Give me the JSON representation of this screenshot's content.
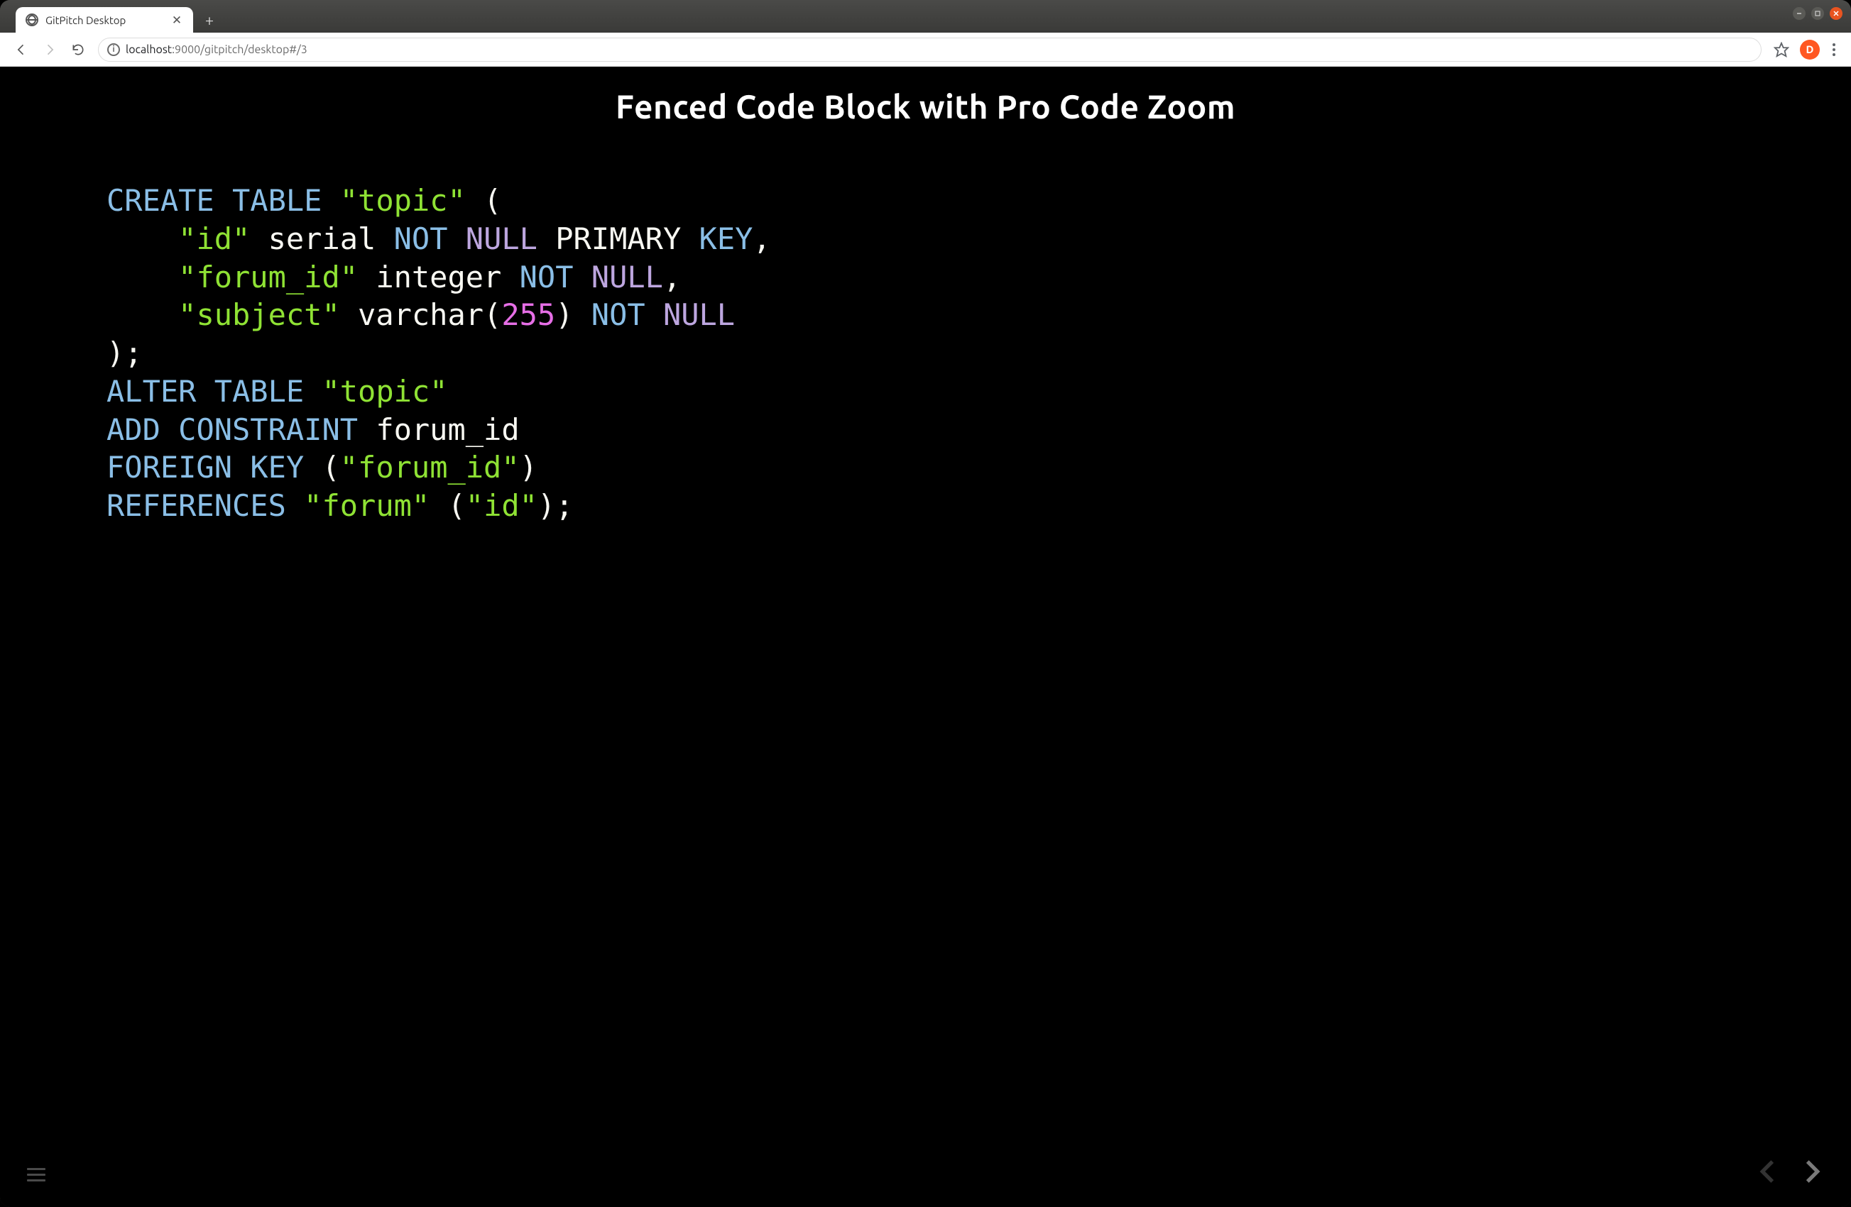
{
  "window": {
    "tab_title": "GitPitch Desktop",
    "controls": {
      "minimize": "minimize",
      "maximize": "maximize",
      "close": "close"
    }
  },
  "toolbar": {
    "url_host": "localhost",
    "url_port_path": ":9000/gitpitch/desktop#/3",
    "avatar_initial": "D"
  },
  "slide": {
    "title": "Fenced Code Block with Pro Code Zoom",
    "code_tokens": [
      [
        {
          "c": "tok-kw",
          "t": "CREATE"
        },
        {
          "c": "sp",
          "t": " "
        },
        {
          "c": "tok-kw",
          "t": "TABLE"
        },
        {
          "c": "sp",
          "t": " "
        },
        {
          "c": "tok-str",
          "t": "\"topic\""
        },
        {
          "c": "sp",
          "t": " "
        },
        {
          "c": "tok-punc",
          "t": "("
        }
      ],
      [
        {
          "c": "sp",
          "t": "    "
        },
        {
          "c": "tok-str",
          "t": "\"id\""
        },
        {
          "c": "sp",
          "t": " "
        },
        {
          "c": "tok-id",
          "t": "serial"
        },
        {
          "c": "sp",
          "t": " "
        },
        {
          "c": "tok-kw",
          "t": "NOT"
        },
        {
          "c": "sp",
          "t": " "
        },
        {
          "c": "tok-pk1",
          "t": "NULL"
        },
        {
          "c": "sp",
          "t": " "
        },
        {
          "c": "tok-id",
          "t": "PRIMARY"
        },
        {
          "c": "sp",
          "t": " "
        },
        {
          "c": "tok-pk2",
          "t": "KEY"
        },
        {
          "c": "tok-punc",
          "t": ","
        }
      ],
      [
        {
          "c": "sp",
          "t": "    "
        },
        {
          "c": "tok-str",
          "t": "\"forum_id\""
        },
        {
          "c": "sp",
          "t": " "
        },
        {
          "c": "tok-id",
          "t": "integer"
        },
        {
          "c": "sp",
          "t": " "
        },
        {
          "c": "tok-kw",
          "t": "NOT"
        },
        {
          "c": "sp",
          "t": " "
        },
        {
          "c": "tok-pk1",
          "t": "NULL"
        },
        {
          "c": "tok-punc",
          "t": ","
        }
      ],
      [
        {
          "c": "sp",
          "t": "    "
        },
        {
          "c": "tok-str",
          "t": "\"subject\""
        },
        {
          "c": "sp",
          "t": " "
        },
        {
          "c": "tok-id",
          "t": "varchar"
        },
        {
          "c": "tok-punc",
          "t": "("
        },
        {
          "c": "tok-num",
          "t": "255"
        },
        {
          "c": "tok-punc",
          "t": ")"
        },
        {
          "c": "sp",
          "t": " "
        },
        {
          "c": "tok-kw",
          "t": "NOT"
        },
        {
          "c": "sp",
          "t": " "
        },
        {
          "c": "tok-pk1",
          "t": "NULL"
        }
      ],
      [
        {
          "c": "tok-punc",
          "t": ");"
        }
      ],
      [
        {
          "c": "tok-kw",
          "t": "ALTER"
        },
        {
          "c": "sp",
          "t": " "
        },
        {
          "c": "tok-kw",
          "t": "TABLE"
        },
        {
          "c": "sp",
          "t": " "
        },
        {
          "c": "tok-str",
          "t": "\"topic\""
        }
      ],
      [
        {
          "c": "tok-kw",
          "t": "ADD"
        },
        {
          "c": "sp",
          "t": " "
        },
        {
          "c": "tok-kw",
          "t": "CONSTRAINT"
        },
        {
          "c": "sp",
          "t": " "
        },
        {
          "c": "tok-id",
          "t": "forum_id"
        }
      ],
      [
        {
          "c": "tok-kw",
          "t": "FOREIGN"
        },
        {
          "c": "sp",
          "t": " "
        },
        {
          "c": "tok-kw",
          "t": "KEY"
        },
        {
          "c": "sp",
          "t": " "
        },
        {
          "c": "tok-punc",
          "t": "("
        },
        {
          "c": "tok-str",
          "t": "\"forum_id\""
        },
        {
          "c": "tok-punc",
          "t": ")"
        }
      ],
      [
        {
          "c": "tok-kw",
          "t": "REFERENCES"
        },
        {
          "c": "sp",
          "t": " "
        },
        {
          "c": "tok-str",
          "t": "\"forum\""
        },
        {
          "c": "sp",
          "t": " "
        },
        {
          "c": "tok-punc",
          "t": "("
        },
        {
          "c": "tok-str",
          "t": "\"id\""
        },
        {
          "c": "tok-punc",
          "t": ");"
        }
      ]
    ]
  }
}
